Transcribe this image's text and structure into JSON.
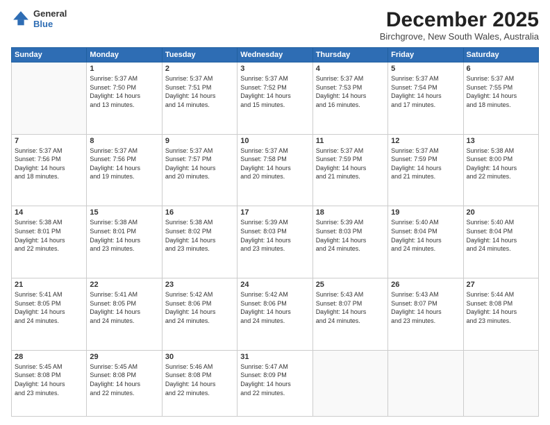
{
  "header": {
    "logo_line1": "General",
    "logo_line2": "Blue",
    "title": "December 2025",
    "subtitle": "Birchgrove, New South Wales, Australia"
  },
  "weekdays": [
    "Sunday",
    "Monday",
    "Tuesday",
    "Wednesday",
    "Thursday",
    "Friday",
    "Saturday"
  ],
  "weeks": [
    [
      {
        "day": "",
        "info": ""
      },
      {
        "day": "1",
        "info": "Sunrise: 5:37 AM\nSunset: 7:50 PM\nDaylight: 14 hours\nand 13 minutes."
      },
      {
        "day": "2",
        "info": "Sunrise: 5:37 AM\nSunset: 7:51 PM\nDaylight: 14 hours\nand 14 minutes."
      },
      {
        "day": "3",
        "info": "Sunrise: 5:37 AM\nSunset: 7:52 PM\nDaylight: 14 hours\nand 15 minutes."
      },
      {
        "day": "4",
        "info": "Sunrise: 5:37 AM\nSunset: 7:53 PM\nDaylight: 14 hours\nand 16 minutes."
      },
      {
        "day": "5",
        "info": "Sunrise: 5:37 AM\nSunset: 7:54 PM\nDaylight: 14 hours\nand 17 minutes."
      },
      {
        "day": "6",
        "info": "Sunrise: 5:37 AM\nSunset: 7:55 PM\nDaylight: 14 hours\nand 18 minutes."
      }
    ],
    [
      {
        "day": "7",
        "info": "Sunrise: 5:37 AM\nSunset: 7:56 PM\nDaylight: 14 hours\nand 18 minutes."
      },
      {
        "day": "8",
        "info": "Sunrise: 5:37 AM\nSunset: 7:56 PM\nDaylight: 14 hours\nand 19 minutes."
      },
      {
        "day": "9",
        "info": "Sunrise: 5:37 AM\nSunset: 7:57 PM\nDaylight: 14 hours\nand 20 minutes."
      },
      {
        "day": "10",
        "info": "Sunrise: 5:37 AM\nSunset: 7:58 PM\nDaylight: 14 hours\nand 20 minutes."
      },
      {
        "day": "11",
        "info": "Sunrise: 5:37 AM\nSunset: 7:59 PM\nDaylight: 14 hours\nand 21 minutes."
      },
      {
        "day": "12",
        "info": "Sunrise: 5:37 AM\nSunset: 7:59 PM\nDaylight: 14 hours\nand 21 minutes."
      },
      {
        "day": "13",
        "info": "Sunrise: 5:38 AM\nSunset: 8:00 PM\nDaylight: 14 hours\nand 22 minutes."
      }
    ],
    [
      {
        "day": "14",
        "info": "Sunrise: 5:38 AM\nSunset: 8:01 PM\nDaylight: 14 hours\nand 22 minutes."
      },
      {
        "day": "15",
        "info": "Sunrise: 5:38 AM\nSunset: 8:01 PM\nDaylight: 14 hours\nand 23 minutes."
      },
      {
        "day": "16",
        "info": "Sunrise: 5:38 AM\nSunset: 8:02 PM\nDaylight: 14 hours\nand 23 minutes."
      },
      {
        "day": "17",
        "info": "Sunrise: 5:39 AM\nSunset: 8:03 PM\nDaylight: 14 hours\nand 23 minutes."
      },
      {
        "day": "18",
        "info": "Sunrise: 5:39 AM\nSunset: 8:03 PM\nDaylight: 14 hours\nand 24 minutes."
      },
      {
        "day": "19",
        "info": "Sunrise: 5:40 AM\nSunset: 8:04 PM\nDaylight: 14 hours\nand 24 minutes."
      },
      {
        "day": "20",
        "info": "Sunrise: 5:40 AM\nSunset: 8:04 PM\nDaylight: 14 hours\nand 24 minutes."
      }
    ],
    [
      {
        "day": "21",
        "info": "Sunrise: 5:41 AM\nSunset: 8:05 PM\nDaylight: 14 hours\nand 24 minutes."
      },
      {
        "day": "22",
        "info": "Sunrise: 5:41 AM\nSunset: 8:05 PM\nDaylight: 14 hours\nand 24 minutes."
      },
      {
        "day": "23",
        "info": "Sunrise: 5:42 AM\nSunset: 8:06 PM\nDaylight: 14 hours\nand 24 minutes."
      },
      {
        "day": "24",
        "info": "Sunrise: 5:42 AM\nSunset: 8:06 PM\nDaylight: 14 hours\nand 24 minutes."
      },
      {
        "day": "25",
        "info": "Sunrise: 5:43 AM\nSunset: 8:07 PM\nDaylight: 14 hours\nand 24 minutes."
      },
      {
        "day": "26",
        "info": "Sunrise: 5:43 AM\nSunset: 8:07 PM\nDaylight: 14 hours\nand 23 minutes."
      },
      {
        "day": "27",
        "info": "Sunrise: 5:44 AM\nSunset: 8:08 PM\nDaylight: 14 hours\nand 23 minutes."
      }
    ],
    [
      {
        "day": "28",
        "info": "Sunrise: 5:45 AM\nSunset: 8:08 PM\nDaylight: 14 hours\nand 23 minutes."
      },
      {
        "day": "29",
        "info": "Sunrise: 5:45 AM\nSunset: 8:08 PM\nDaylight: 14 hours\nand 22 minutes."
      },
      {
        "day": "30",
        "info": "Sunrise: 5:46 AM\nSunset: 8:08 PM\nDaylight: 14 hours\nand 22 minutes."
      },
      {
        "day": "31",
        "info": "Sunrise: 5:47 AM\nSunset: 8:09 PM\nDaylight: 14 hours\nand 22 minutes."
      },
      {
        "day": "",
        "info": ""
      },
      {
        "day": "",
        "info": ""
      },
      {
        "day": "",
        "info": ""
      }
    ]
  ]
}
